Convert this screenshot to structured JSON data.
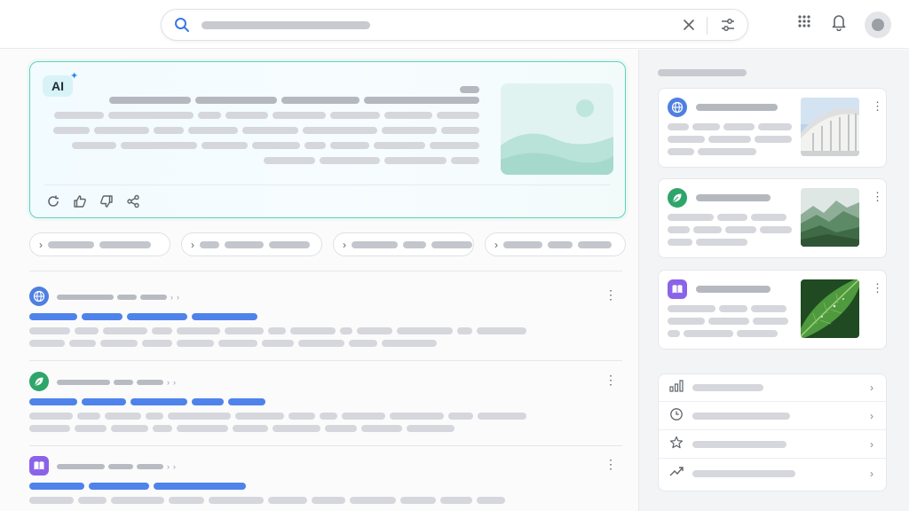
{
  "topbar": {
    "search": {
      "query": ""
    },
    "icons": [
      "search-icon",
      "clear-icon",
      "filter-icon",
      "apps-grid-icon",
      "bell-icon",
      "avatar"
    ]
  },
  "ai_overview": {
    "badge": "AI",
    "actions": [
      "regenerate-icon",
      "thumbs-up-icon",
      "thumbs-down-icon",
      "share-icon"
    ]
  },
  "colors": {
    "accent_blue": "#4f83ea",
    "ai_border": "#5fd3b7",
    "globe_icon_bg": "#4f7fe0",
    "leaf_icon_bg": "#2ea56a",
    "book_icon_bg": "#8a63e8"
  },
  "results": [
    {
      "icon": "globe-icon"
    },
    {
      "icon": "leaf-icon"
    },
    {
      "icon": "book-icon"
    }
  ],
  "sidebar": {
    "cards": [
      {
        "icon": "globe-icon",
        "image": "building-photo"
      },
      {
        "icon": "leaf-icon",
        "image": "mountains-photo"
      },
      {
        "icon": "book-icon",
        "image": "leaf-photo"
      }
    ],
    "links": [
      {
        "icon": "bar-chart-icon"
      },
      {
        "icon": "clock-icon"
      },
      {
        "icon": "star-icon"
      },
      {
        "icon": "trending-up-icon"
      }
    ]
  }
}
